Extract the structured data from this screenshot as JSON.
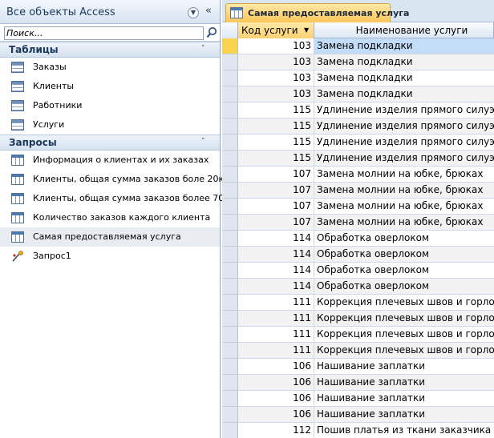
{
  "nav": {
    "title": "Все объекты Access",
    "search": {
      "placeholder": "Поиск..."
    },
    "groups": [
      {
        "title": "Таблицы",
        "items": [
          {
            "label": "Заказы",
            "icon": "table-icon"
          },
          {
            "label": "Клиенты",
            "icon": "table-icon"
          },
          {
            "label": "Работники",
            "icon": "table-icon"
          },
          {
            "label": "Услуги",
            "icon": "table-icon"
          }
        ]
      },
      {
        "title": "Запросы",
        "items": [
          {
            "label": "Информация о клиентах и их заказах",
            "icon": "query-icon"
          },
          {
            "label": "Клиенты, общая сумма заказов боле 20к",
            "icon": "query-icon"
          },
          {
            "label": "Клиенты, общая сумма заказов более 70...",
            "icon": "query-icon"
          },
          {
            "label": "Количество заказов каждого клиента",
            "icon": "query-icon"
          },
          {
            "label": "Самая предоставляемая услуга",
            "icon": "query-icon",
            "selected": true
          },
          {
            "label": "Запрос1",
            "icon": "query-design-icon"
          }
        ]
      }
    ]
  },
  "document": {
    "tab_label": "Самая предоставляемая услуга",
    "columns": {
      "code": "Код услуги",
      "name": "Наименование услуги"
    },
    "rows": [
      {
        "code": "103",
        "name": "Замена подкладки"
      },
      {
        "code": "103",
        "name": "Замена подкладки"
      },
      {
        "code": "103",
        "name": "Замена подкладки"
      },
      {
        "code": "103",
        "name": "Замена подкладки"
      },
      {
        "code": "115",
        "name": "Удлинение изделия прямого силуэ"
      },
      {
        "code": "115",
        "name": "Удлинение изделия прямого силуэ"
      },
      {
        "code": "115",
        "name": "Удлинение изделия прямого силуэ"
      },
      {
        "code": "115",
        "name": "Удлинение изделия прямого силуэ"
      },
      {
        "code": "107",
        "name": "Замена молнии на юбке, брюках"
      },
      {
        "code": "107",
        "name": "Замена молнии на юбке, брюках"
      },
      {
        "code": "107",
        "name": "Замена молнии на юбке, брюках"
      },
      {
        "code": "107",
        "name": "Замена молнии на юбке, брюках"
      },
      {
        "code": "114",
        "name": "Обработка оверлоком"
      },
      {
        "code": "114",
        "name": "Обработка оверлоком"
      },
      {
        "code": "114",
        "name": "Обработка оверлоком"
      },
      {
        "code": "114",
        "name": "Обработка оверлоком"
      },
      {
        "code": "111",
        "name": "Коррекция плечевых швов и горло"
      },
      {
        "code": "111",
        "name": "Коррекция плечевых швов и горло"
      },
      {
        "code": "111",
        "name": "Коррекция плечевых швов и горло"
      },
      {
        "code": "111",
        "name": "Коррекция плечевых швов и горло"
      },
      {
        "code": "106",
        "name": "Нашивание заплатки"
      },
      {
        "code": "106",
        "name": "Нашивание заплатки"
      },
      {
        "code": "106",
        "name": "Нашивание заплатки"
      },
      {
        "code": "106",
        "name": "Нашивание заплатки"
      },
      {
        "code": "112",
        "name": "Пошив платья из ткани заказчика"
      }
    ]
  },
  "colors": {
    "selected_row": "#c3dcf8",
    "active_tab": "#fcc65a",
    "nav_header": "#d7e4f2"
  }
}
